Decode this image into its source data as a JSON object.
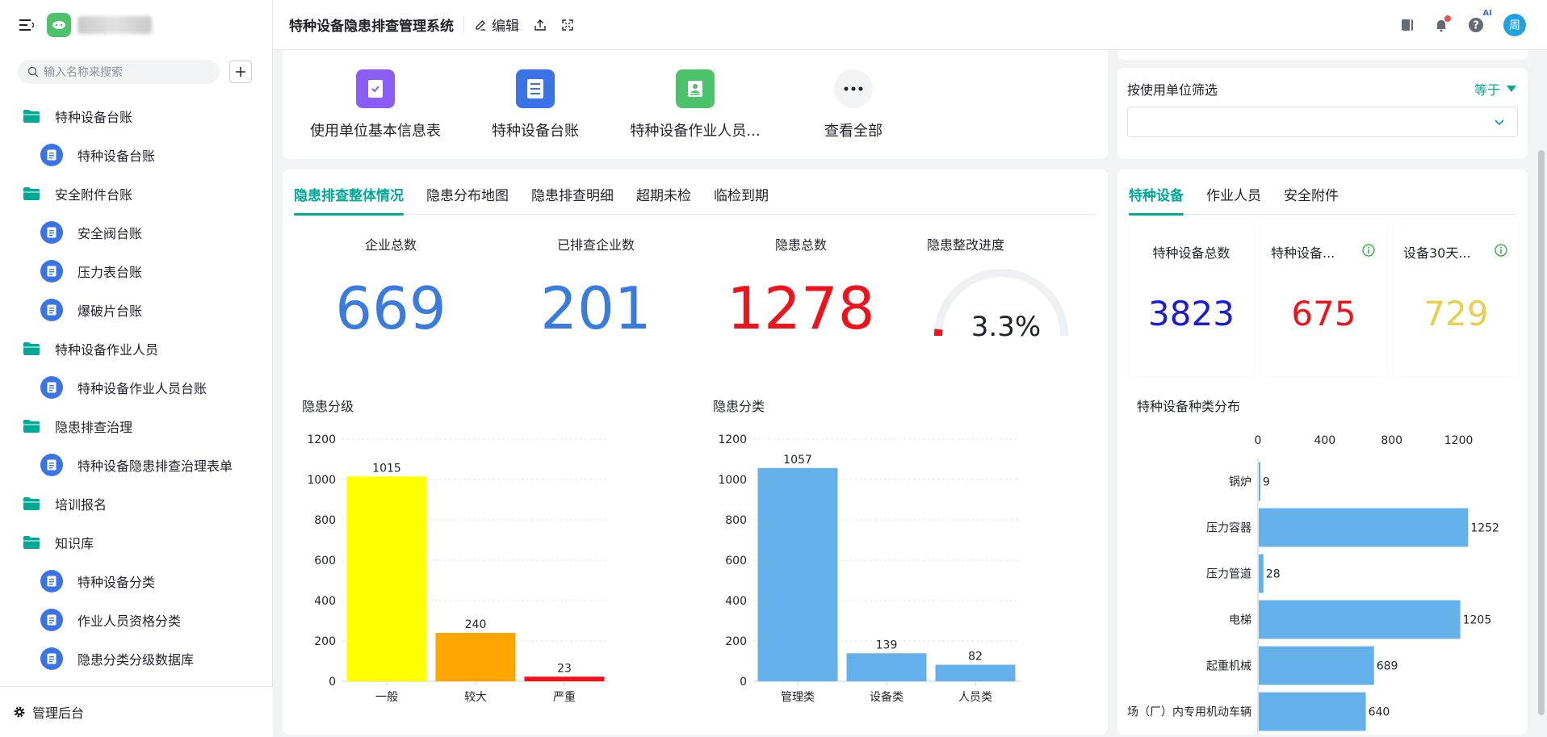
{
  "sidebar": {
    "search_placeholder": "输入名称来搜索",
    "items": [
      {
        "type": "folder",
        "label": "特种设备台账"
      },
      {
        "type": "leaf",
        "label": "特种设备台账"
      },
      {
        "type": "folder",
        "label": "安全附件台账"
      },
      {
        "type": "leaf",
        "label": "安全阀台账"
      },
      {
        "type": "leaf",
        "label": "压力表台账"
      },
      {
        "type": "leaf",
        "label": "爆破片台账"
      },
      {
        "type": "folder",
        "label": "特种设备作业人员"
      },
      {
        "type": "leaf",
        "label": "特种设备作业人员台账"
      },
      {
        "type": "folder",
        "label": "隐患排查治理"
      },
      {
        "type": "leaf",
        "label": "特种设备隐患排查治理表单"
      },
      {
        "type": "folder",
        "label": "培训报名"
      },
      {
        "type": "folder",
        "label": "知识库"
      },
      {
        "type": "leaf",
        "label": "特种设备分类"
      },
      {
        "type": "leaf",
        "label": "作业人员资格分类"
      },
      {
        "type": "leaf",
        "label": "隐患分类分级数据库"
      }
    ],
    "admin_label": "管理后台"
  },
  "header": {
    "title": "特种设备隐患排查管理系统",
    "edit_label": "编辑",
    "ai_label": "AI",
    "avatar_text": "周"
  },
  "shortcuts": [
    {
      "label": "使用单位基本信息表",
      "color": "#8b5cf6",
      "icon": "checklist-icon"
    },
    {
      "label": "特种设备台账",
      "color": "#3a73e8",
      "icon": "document-icon"
    },
    {
      "label": "特种设备作业人员...",
      "color": "#4cc26a",
      "icon": "person-icon"
    },
    {
      "label": "查看全部",
      "color": "#f2f3f5",
      "icon": "more-icon"
    }
  ],
  "filter": {
    "label": "按使用单位筛选",
    "operator": "等于",
    "value": ""
  },
  "tabs": [
    "隐患排查整体情况",
    "隐患分布地图",
    "隐患排查明细",
    "超期未检",
    "临检到期"
  ],
  "kpis": [
    {
      "label": "企业总数",
      "value": "669",
      "color": "#3a7be0"
    },
    {
      "label": "已排查企业数",
      "value": "201",
      "color": "#3a7be0"
    },
    {
      "label": "隐患总数",
      "value": "1278",
      "color": "#f0121b"
    }
  ],
  "gauge": {
    "label": "隐患整改进度",
    "value": "3.3%",
    "fraction": 0.033,
    "color": "#f0121b"
  },
  "right_tabs": [
    "特种设备",
    "作业人员",
    "安全附件"
  ],
  "right_kpis": [
    {
      "label": "特种设备总数",
      "value": "3823",
      "color": "#1a1adb",
      "info": false
    },
    {
      "label": "特种设备...",
      "value": "675",
      "color": "#f0121b",
      "info": true
    },
    {
      "label": "设备30天...",
      "value": "729",
      "color": "#e8cf4c",
      "info": true
    }
  ],
  "chart_data": [
    {
      "type": "bar",
      "title": "隐患分级",
      "categories": [
        "一般",
        "较大",
        "严重"
      ],
      "values": [
        1015,
        240,
        23
      ],
      "colors": [
        "#ffff00",
        "#ffa500",
        "#f0121b"
      ],
      "ylim": [
        0,
        1200
      ],
      "yticks": [
        0,
        200,
        400,
        600,
        800,
        1000,
        1200
      ],
      "grid": true
    },
    {
      "type": "bar",
      "title": "隐患分类",
      "categories": [
        "管理类",
        "设备类",
        "人员类"
      ],
      "values": [
        1057,
        139,
        82
      ],
      "colors": [
        "#64b0ea",
        "#64b0ea",
        "#64b0ea"
      ],
      "ylim": [
        0,
        1200
      ],
      "yticks": [
        0,
        200,
        400,
        600,
        800,
        1000,
        1200
      ],
      "grid": true
    },
    {
      "type": "bar",
      "orientation": "horizontal",
      "title": "特种设备种类分布",
      "categories": [
        "锅炉",
        "压力容器",
        "压力管道",
        "电梯",
        "起重机械",
        "场（厂）内专用机动车辆"
      ],
      "values": [
        9,
        1252,
        28,
        1205,
        689,
        640
      ],
      "colors": [
        "#64b0ea"
      ],
      "xlim": [
        0,
        1400
      ],
      "xticks": [
        0,
        400,
        800,
        1200
      ],
      "grid": false
    }
  ]
}
